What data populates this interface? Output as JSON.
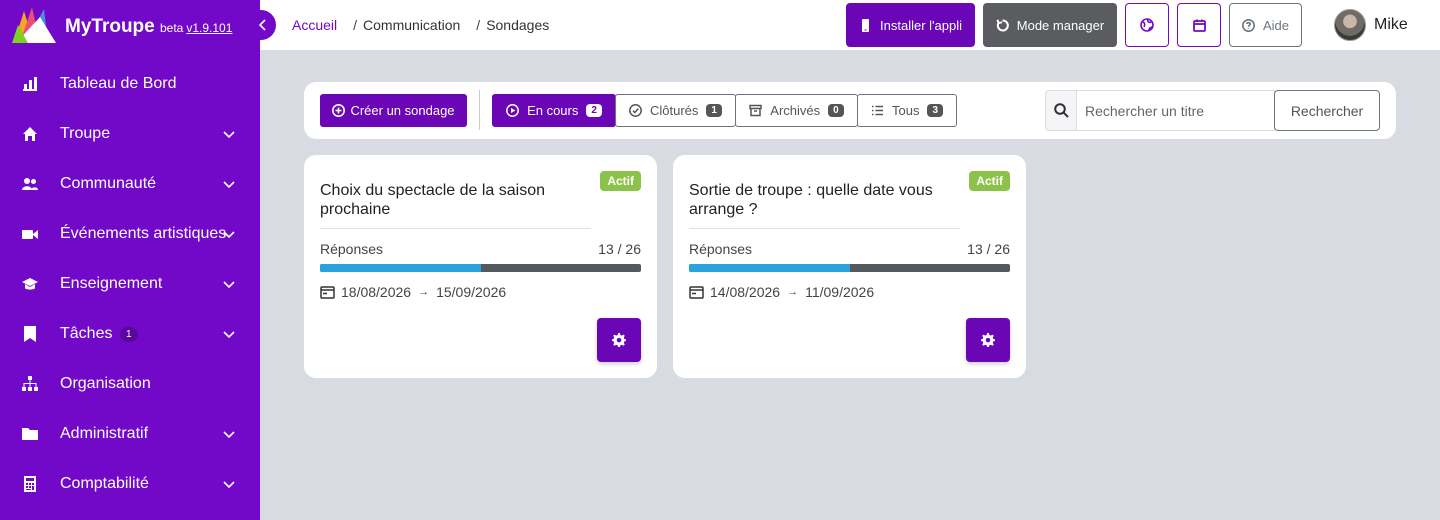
{
  "brand": {
    "name": "MyTroupe",
    "beta": "beta",
    "version": "v1.9.101"
  },
  "sidebar": {
    "items": [
      {
        "label": "Tableau de Bord",
        "icon": "chart-bars-icon"
      },
      {
        "label": "Troupe",
        "icon": "home-icon"
      },
      {
        "label": "Communauté",
        "icon": "users-icon"
      },
      {
        "label": "Événements artistiques",
        "icon": "video-camera-icon"
      },
      {
        "label": "Enseignement",
        "icon": "graduation-cap-icon"
      },
      {
        "label": "Tâches",
        "icon": "tasks-icon",
        "badge": "1"
      },
      {
        "label": "Organisation",
        "icon": "org-chart-icon"
      },
      {
        "label": "Administratif",
        "icon": "folder-icon"
      },
      {
        "label": "Comptabilité",
        "icon": "calculator-icon"
      }
    ]
  },
  "breadcrumb": {
    "home": "Accueil",
    "section": "Communication",
    "page": "Sondages",
    "separator": "/"
  },
  "topbar": {
    "install": "Installer l'appli",
    "manager": "Mode manager",
    "help": "Aide",
    "user": "Mike"
  },
  "toolbar": {
    "create": "Créer un sondage",
    "filters": [
      {
        "label": "En cours",
        "count": "2",
        "active": true
      },
      {
        "label": "Clôturés",
        "count": "1",
        "active": false
      },
      {
        "label": "Archivés",
        "count": "0",
        "active": false
      },
      {
        "label": "Tous",
        "count": "3",
        "active": false
      }
    ],
    "search_placeholder": "Rechercher un titre",
    "search_button": "Rechercher"
  },
  "polls": [
    {
      "status": "Actif",
      "title": "Choix du spectacle de la saison prochaine",
      "responses_label": "Réponses",
      "responses": "13 / 26",
      "progress": 0.5,
      "start": "18/08/2026",
      "end": "15/09/2026"
    },
    {
      "status": "Actif",
      "title": "Sortie de troupe : quelle date vous arrange ?",
      "responses_label": "Réponses",
      "responses": "13 / 26",
      "progress": 0.5,
      "start": "14/08/2026",
      "end": "11/09/2026"
    }
  ],
  "colors": {
    "primary": "#7209c9",
    "button": "#6a06b5",
    "success": "#8bc34a",
    "progress": "#2aa3dc",
    "background": "#d8dbe2"
  }
}
